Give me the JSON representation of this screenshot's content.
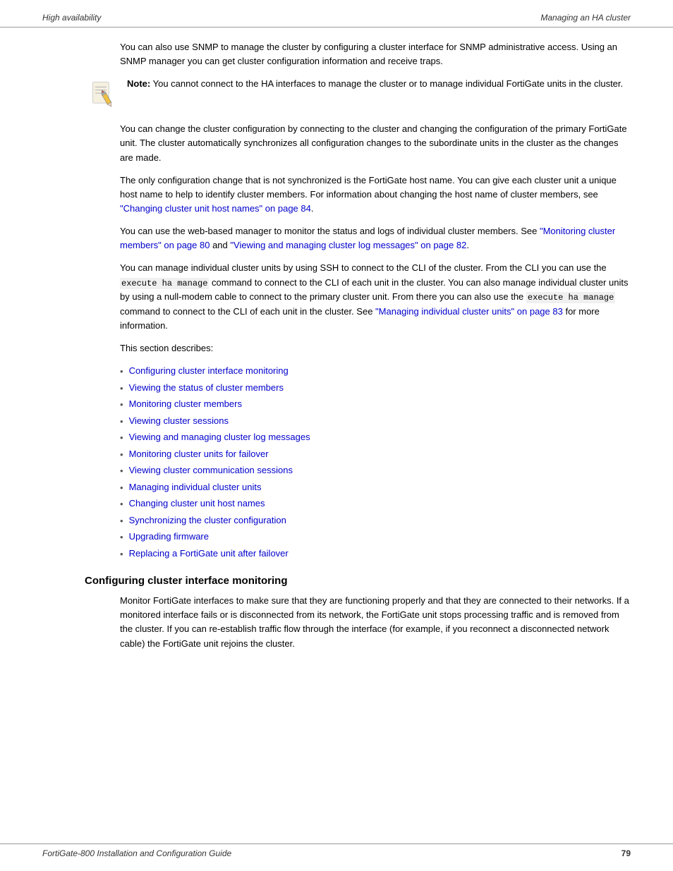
{
  "header": {
    "left": "High availability",
    "right": "Managing an HA cluster"
  },
  "footer": {
    "left": "FortiGate-800 Installation and Configuration Guide",
    "page_number": "79"
  },
  "paragraphs": {
    "snmp_para": "You can also use SNMP to manage the cluster by configuring a cluster interface for SNMP administrative access. Using an SNMP manager you can get cluster configuration information and receive traps.",
    "note_label": "Note:",
    "note_text": "You cannot connect to the HA interfaces to manage the cluster or to manage individual FortiGate units in the cluster.",
    "change_config_para": "You can change the cluster configuration by connecting to the cluster and changing the configuration of the primary FortiGate unit. The cluster automatically synchronizes all configuration changes to the subordinate units in the cluster as the changes are made.",
    "hostname_para_1": "The only configuration change that is not synchronized is the FortiGate host name. You can give each cluster unit a unique host name to help to identify cluster members. For information about changing the host name of cluster members, see ",
    "hostname_link": "\"Changing cluster unit host names\" on page 84",
    "hostname_para_end": ".",
    "webmanager_para_1": "You can use the web-based manager to monitor the status and logs of individual cluster members. See ",
    "webmanager_link1": "\"Monitoring cluster members\" on page 80",
    "webmanager_and": " and ",
    "webmanager_link2": "\"Viewing and managing cluster log messages\" on page 82",
    "webmanager_para_end": ".",
    "ssh_para_1": "You can manage individual cluster units by using SSH to connect to the CLI of the cluster. From the CLI you can use the ",
    "ssh_code1": "execute ha manage",
    "ssh_para_2": " command to connect to the CLI of each unit in the cluster. You can also manage individual cluster units by using a null-modem cable to connect to the primary cluster unit. From there you can also use the ",
    "ssh_code2": "execute ha manage",
    "ssh_para_3": " command to connect to the CLI of each unit in the cluster. See ",
    "ssh_link": "\"Managing individual cluster units\" on page 83",
    "ssh_para_end": " for more information.",
    "section_describes": "This section describes:"
  },
  "bullet_list": [
    {
      "text": "Configuring cluster interface monitoring",
      "link": true
    },
    {
      "text": "Viewing the status of cluster members",
      "link": true
    },
    {
      "text": "Monitoring cluster members",
      "link": true
    },
    {
      "text": "Viewing cluster sessions",
      "link": true
    },
    {
      "text": "Viewing and managing cluster log messages",
      "link": true
    },
    {
      "text": "Monitoring cluster units for failover",
      "link": true
    },
    {
      "text": "Viewing cluster communication sessions",
      "link": true
    },
    {
      "text": "Managing individual cluster units",
      "link": true
    },
    {
      "text": "Changing cluster unit host names",
      "link": true
    },
    {
      "text": "Synchronizing the cluster configuration",
      "link": true
    },
    {
      "text": "Upgrading firmware",
      "link": true
    },
    {
      "text": "Replacing a FortiGate unit after failover",
      "link": true
    }
  ],
  "section_heading": "Configuring cluster interface monitoring",
  "section_para": "Monitor FortiGate interfaces to make sure that they are functioning properly and that they are connected to their networks. If a monitored interface fails or is disconnected from its network, the FortiGate unit stops processing traffic and is removed from the cluster. If you can re-establish traffic flow through the interface (for example, if you reconnect a disconnected network cable) the FortiGate unit rejoins the cluster."
}
